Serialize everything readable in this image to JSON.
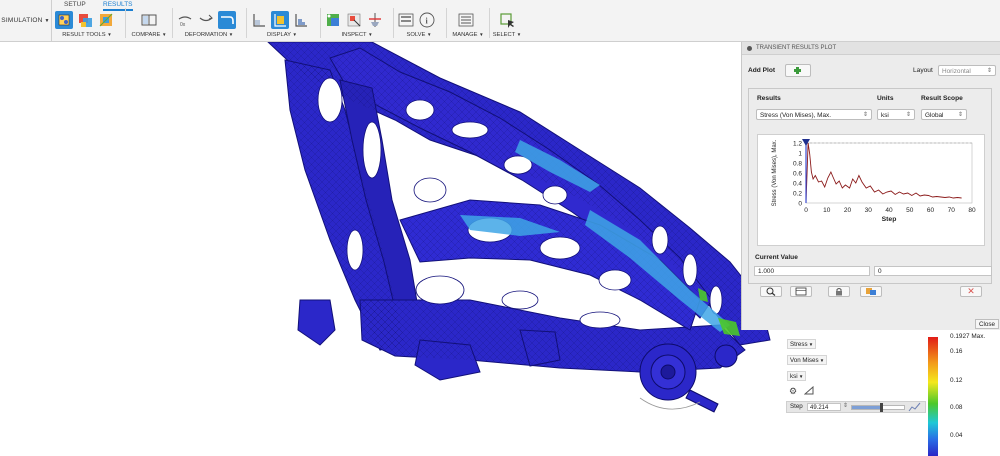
{
  "toolbar": {
    "workspace": "SIMULATION",
    "tabs": [
      "SETUP",
      "RESULTS"
    ],
    "groups": {
      "result_tools": "RESULT TOOLS",
      "compare": "COMPARE",
      "deformation": "DEFORMATION",
      "display": "DISPLAY",
      "inspect": "INSPECT",
      "solve": "SOLVE",
      "manage": "MANAGE",
      "select": "SELECT"
    }
  },
  "plot_panel": {
    "title": "TRANSIENT RESULTS PLOT",
    "add_plot_label": "Add Plot",
    "layout_label": "Layout",
    "layout_value": "Horizontal",
    "results_header": "Results",
    "units_header": "Units",
    "scope_header": "Result Scope",
    "results_value": "Stress (Von Mises), Max.",
    "units_value": "ksi",
    "scope_value": "Global",
    "current_value_label": "Current Value",
    "current_value": "1.000",
    "current_step_value": "0",
    "close_label": "Close"
  },
  "chart_data": {
    "type": "line",
    "xlabel": "Step",
    "ylabel": "Stress (Von Mises), Max.",
    "xlim": [
      0,
      80
    ],
    "ylim": [
      0,
      1.2
    ],
    "x_ticks": [
      0,
      10,
      20,
      30,
      40,
      50,
      60,
      70,
      80
    ],
    "y_ticks": [
      0,
      0.2,
      0.4,
      0.6,
      0.8,
      1,
      1.2
    ],
    "grid": true,
    "series": [
      {
        "color": "#8b1a1a",
        "x": [
          0,
          1,
          1.8,
          2.6,
          3.4,
          4.5,
          6,
          7.5,
          9,
          10.5,
          12,
          13,
          14.5,
          16,
          17.5,
          19,
          21,
          22.5,
          24,
          25.5,
          27,
          29,
          31,
          33,
          35,
          37,
          39,
          41,
          43,
          45,
          47,
          49,
          51,
          53,
          55,
          57,
          59,
          61,
          63,
          65,
          67,
          69,
          71,
          73,
          75
        ],
        "y": [
          0,
          1.2,
          0.98,
          0.62,
          0.48,
          0.55,
          0.42,
          0.44,
          0.32,
          0.5,
          0.62,
          0.52,
          0.38,
          0.44,
          0.3,
          0.36,
          0.3,
          0.48,
          0.4,
          0.55,
          0.42,
          0.3,
          0.34,
          0.22,
          0.26,
          0.18,
          0.22,
          0.24,
          0.17,
          0.22,
          0.18,
          0.2,
          0.15,
          0.2,
          0.14,
          0.16,
          0.15,
          0.12,
          0.13,
          0.12,
          0.11,
          0.12,
          0.1,
          0.11,
          0.1
        ]
      }
    ],
    "marker_step": 0
  },
  "result_controls": {
    "result_type": "Stress",
    "criterion": "Von Mises",
    "units": "ksi",
    "step_label": "Step",
    "step_value": "49.214"
  },
  "legend": {
    "max_label": "0.1927 Max.",
    "ticks": [
      "0.16",
      "0.12",
      "0.08",
      "0.04"
    ]
  },
  "colors": {
    "accent": "#2b8ad6",
    "mesh_blue": "#2b27c9",
    "plot_line": "#8b1a1a"
  }
}
